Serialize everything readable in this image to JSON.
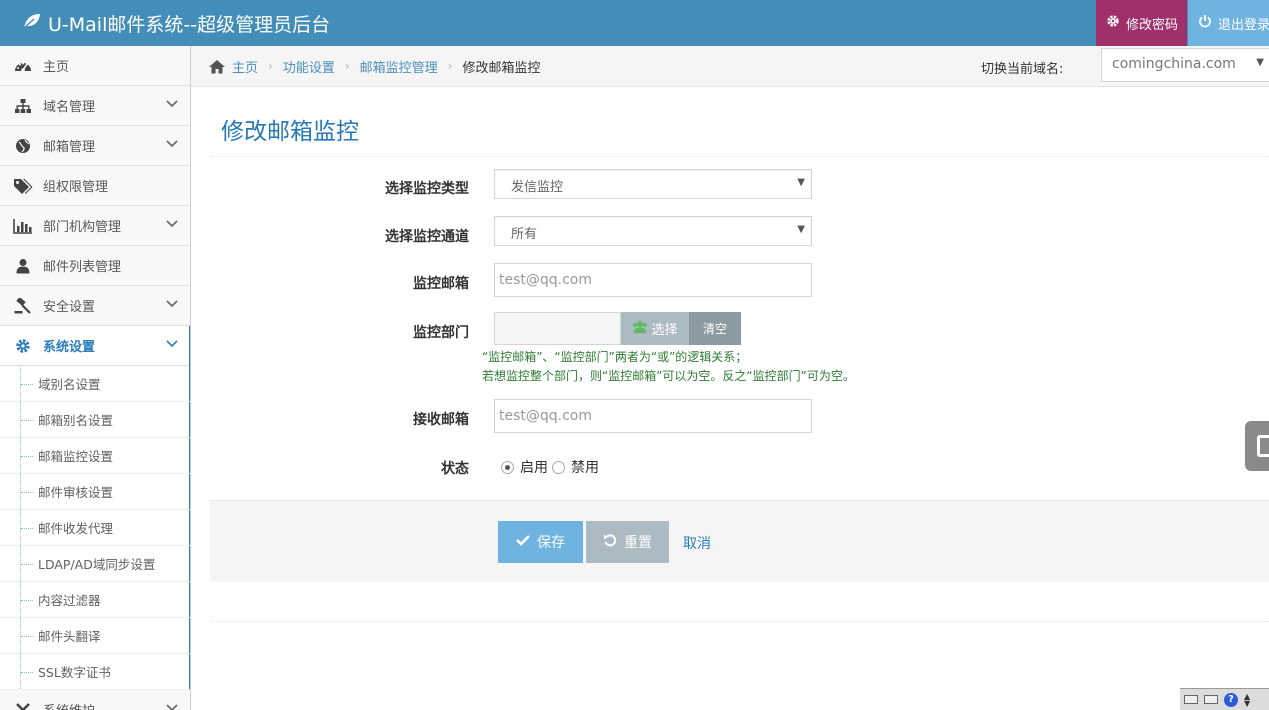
{
  "header": {
    "brand": "U-Mail邮件系统--超级管理员后台",
    "change_password": "修改密码",
    "logout": "退出登录"
  },
  "sidebar": {
    "items": [
      {
        "label": "主页",
        "icon": "dashboard-icon"
      },
      {
        "label": "域名管理",
        "icon": "sitemap-icon"
      },
      {
        "label": "邮箱管理",
        "icon": "globe-icon"
      },
      {
        "label": "组权限管理",
        "icon": "tags-icon"
      },
      {
        "label": "部门机构管理",
        "icon": "bar-chart-icon"
      },
      {
        "label": "邮件列表管理",
        "icon": "user-icon"
      },
      {
        "label": "安全设置",
        "icon": "gavel-icon"
      },
      {
        "label": "系统设置",
        "icon": "cog-icon"
      }
    ],
    "subitems": [
      "域别名设置",
      "邮箱别名设置",
      "邮箱监控设置",
      "邮件审核设置",
      "邮件收发代理",
      "LDAP/AD域同步设置",
      "内容过滤器",
      "邮件头翻译",
      "SSL数字证书"
    ],
    "last_item": "系统维护"
  },
  "breadcrumb": {
    "home": "主页",
    "level1": "功能设置",
    "level2": "邮箱监控管理",
    "current": "修改邮箱监控"
  },
  "domain": {
    "label": "切换当前域名:",
    "value": "comingchina.com"
  },
  "page": {
    "title": "修改邮箱监控"
  },
  "form": {
    "monitor_type_label": "选择监控类型",
    "monitor_type_value": "发信监控",
    "channel_label": "选择监控通道",
    "channel_value": "所有",
    "monitor_mailbox_label": "监控邮箱",
    "monitor_mailbox_placeholder": "test@qq.com",
    "dept_label": "监控部门",
    "dept_select": "选择",
    "dept_clear": "清空",
    "hint1": "“监控邮箱”、“监控部门”两者为“或”的逻辑关系；",
    "hint2": "若想监控整个部门，则“监控邮箱”可以为空。反之“监控部门”可为空。",
    "receive_label": "接收邮箱",
    "receive_placeholder": "test@qq.com",
    "status_label": "状态",
    "status_on": "启用",
    "status_off": "禁用",
    "status_selected": "启用"
  },
  "actions": {
    "save": "保存",
    "reset": "重置",
    "cancel": "取消"
  },
  "colors": {
    "header": "#438eb9",
    "change_password_bg": "#a0306a",
    "logout_bg": "#6fb3e0",
    "accent": "#2b7dbc",
    "hint_text": "#2e7d32"
  }
}
